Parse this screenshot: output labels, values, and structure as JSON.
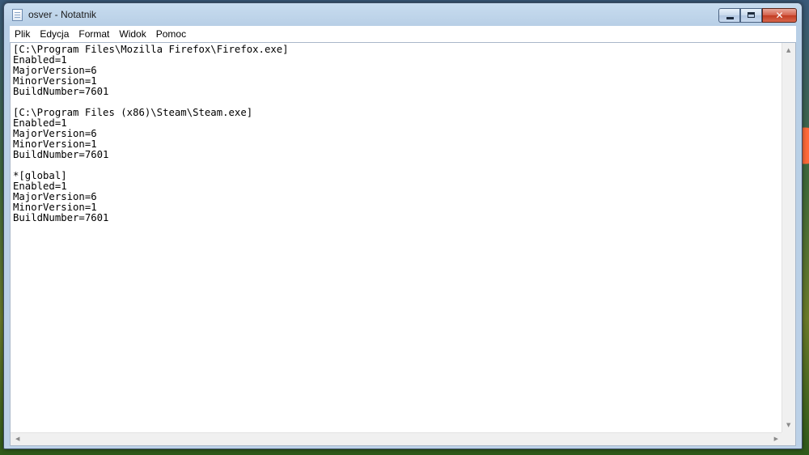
{
  "window": {
    "title": "osver - Notatnik"
  },
  "menu": {
    "items": [
      {
        "label": "Plik"
      },
      {
        "label": "Edycja"
      },
      {
        "label": "Format"
      },
      {
        "label": "Widok"
      },
      {
        "label": "Pomoc"
      }
    ]
  },
  "editor": {
    "lines": [
      "[C:\\Program Files\\Mozilla Firefox\\Firefox.exe]",
      "Enabled=1",
      "MajorVersion=6",
      "MinorVersion=1",
      "BuildNumber=7601",
      "",
      "[C:\\Program Files (x86)\\Steam\\Steam.exe]",
      "Enabled=1",
      "MajorVersion=6",
      "MinorVersion=1",
      "BuildNumber=7601",
      "",
      "*[global]",
      "Enabled=1",
      "MajorVersion=6",
      "MinorVersion=1",
      "BuildNumber=7601"
    ]
  },
  "icons": {
    "app": "notepad-icon",
    "minimize": "minimize-icon",
    "maximize": "maximize-icon",
    "close": "close-icon"
  }
}
